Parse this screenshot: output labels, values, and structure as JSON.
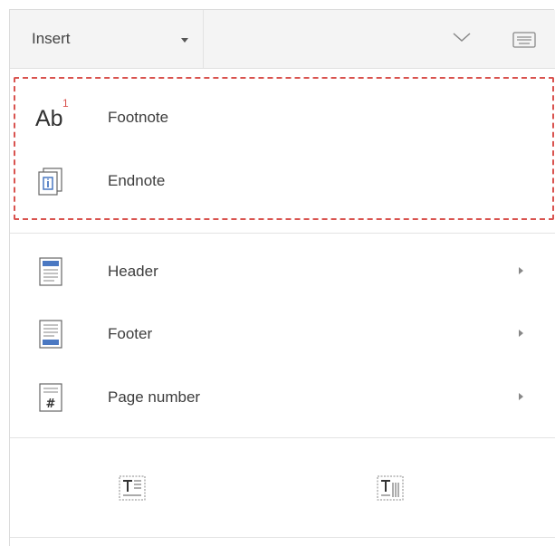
{
  "toolbar": {
    "tab_label": "Insert",
    "caret_icon": "dropdown-caret-icon",
    "collapse_icon": "chevron-down-icon",
    "keyboard_icon": "keyboard-icon"
  },
  "notes_group": {
    "items": [
      {
        "label": "Footnote",
        "icon": "footnote-icon",
        "icon_text": "Ab",
        "icon_sup": "1"
      },
      {
        "label": "Endnote",
        "icon": "endnote-icon"
      }
    ]
  },
  "header_footer_group": {
    "items": [
      {
        "label": "Header",
        "icon": "header-icon",
        "has_submenu": true
      },
      {
        "label": "Footer",
        "icon": "footer-icon",
        "has_submenu": true
      },
      {
        "label": "Page number",
        "icon": "page-number-icon",
        "icon_text": "#",
        "has_submenu": true
      }
    ]
  },
  "bottom_buttons": [
    {
      "icon": "textbox-horizontal-icon"
    },
    {
      "icon": "textbox-vertical-icon"
    }
  ],
  "colors": {
    "highlight_border": "#d9534f",
    "icon_blue": "#4a78c2",
    "toolbar_bg": "#f4f4f4"
  }
}
